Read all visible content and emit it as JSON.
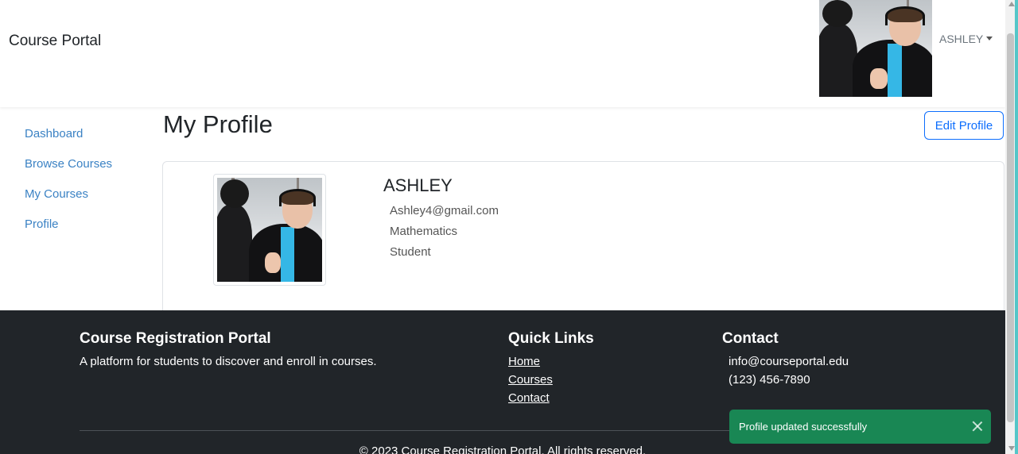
{
  "header": {
    "brand": "Course Portal",
    "user_name": "ASHLEY"
  },
  "sidebar": {
    "items": [
      {
        "label": "Dashboard"
      },
      {
        "label": "Browse Courses"
      },
      {
        "label": "My Courses"
      },
      {
        "label": "Profile"
      }
    ]
  },
  "main": {
    "title": "My Profile",
    "edit_button": "Edit Profile",
    "profile": {
      "name": "ASHLEY",
      "email": "Ashley4@gmail.com",
      "department": "Mathematics",
      "role": "Student"
    }
  },
  "footer": {
    "about_title": "Course Registration Portal",
    "about_text": "A platform for students to discover and enroll in courses.",
    "links_title": "Quick Links",
    "links": [
      {
        "label": "Home"
      },
      {
        "label": "Courses"
      },
      {
        "label": "Contact"
      }
    ],
    "contact_title": "Contact",
    "email": "info@courseportal.edu",
    "phone": "(123) 456-7890",
    "copyright": "© 2023 Course Registration Portal. All rights reserved."
  },
  "toast": {
    "message": "Profile updated successfully"
  },
  "colors": {
    "link": "#3b82c4",
    "primary": "#0d6efd",
    "footer_bg": "#212529",
    "toast_bg": "#198754",
    "shirt": "#35b7e6"
  }
}
